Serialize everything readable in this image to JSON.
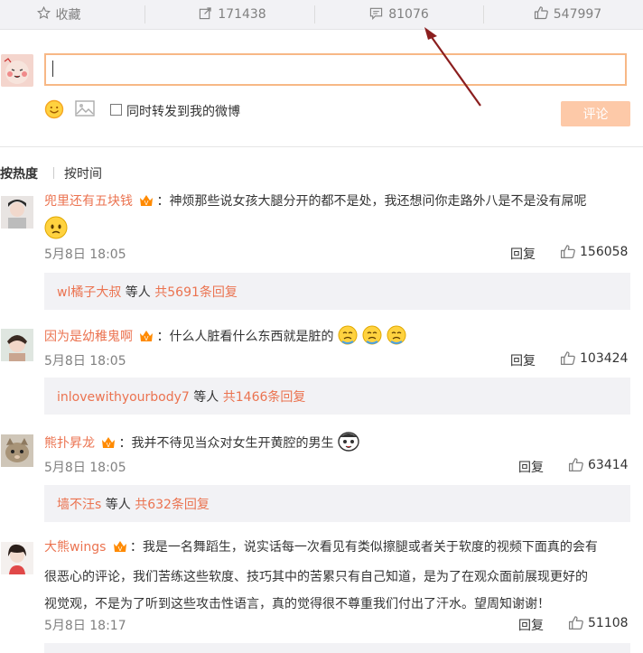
{
  "top_bar": {
    "favorite_label": "收藏",
    "repost_count": "171438",
    "comment_count": "81076",
    "like_count": "547997"
  },
  "composer": {
    "forward_label": "同时转发到我的微博",
    "submit_label": "评论"
  },
  "sort": {
    "hot_label": "按热度",
    "time_label": "按时间"
  },
  "comments": [
    {
      "user": "兜里还有五块钱",
      "text": "：神烦那些说女孩大腿分开的都不是处，我还想问你走路外八是不是没有屌呢",
      "time": "5月8日 18:05",
      "reply_label": "回复",
      "likes": "156058",
      "sub_user": "wl橘子大叔",
      "sub_mid": " 等人 ",
      "sub_total": "共5691条回复"
    },
    {
      "user": "因为是幼稚鬼啊",
      "text": "：什么人脏看什么东西就是脏的",
      "time": "5月8日 18:05",
      "reply_label": "回复",
      "likes": "103424",
      "sub_user": "inlovewithyourbody7",
      "sub_mid": " 等人 ",
      "sub_total": "共1466条回复"
    },
    {
      "user": "熊扑昇龙",
      "text": "：我并不待见当众对女生开黄腔的男生",
      "time": "5月8日 18:05",
      "reply_label": "回复",
      "likes": "63414",
      "sub_user": "墙不汪s",
      "sub_mid": " 等人 ",
      "sub_total": "共632条回复"
    },
    {
      "user": "大熊wings",
      "text_line1": "：我是一名舞蹈生，说实话每一次看见有类似擦腿或者关于软度的视频下面真的会有",
      "text_line2": "很恶心的评论，我们苦练这些软度、技巧其中的苦累只有自己知道，是为了在观众面前展现更好的",
      "text_line3": "视觉观，不是为了听到这些攻击性语言，真的觉得很不尊重我们付出了汗水。望周知谢谢！",
      "time": "5月8日 18:17",
      "reply_label": "回复",
      "likes": "51108"
    }
  ],
  "colors": {
    "username": "#eb7350",
    "bar_bg": "#f2f2f5",
    "input_border": "#f7b886",
    "submit_bg": "#fdc9a8",
    "arrow": "#8b1e1e"
  }
}
